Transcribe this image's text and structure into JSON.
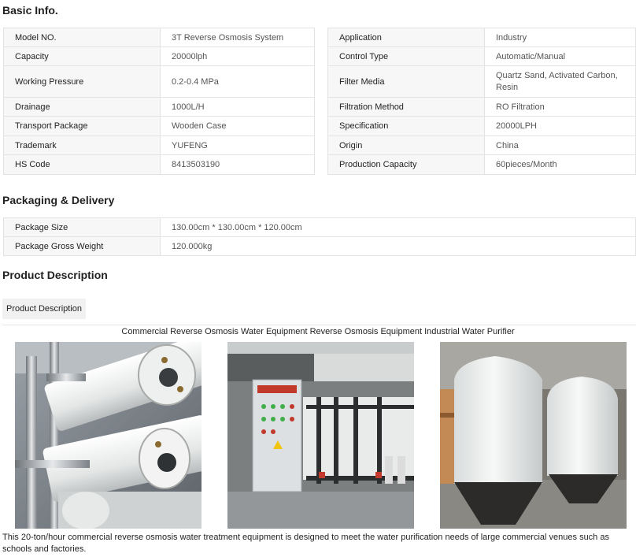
{
  "sections": {
    "basic": "Basic Info.",
    "packaging": "Packaging & Delivery",
    "product": "Product Description"
  },
  "basic_left": [
    {
      "k": "Model NO.",
      "v": "3T Reverse Osmosis System"
    },
    {
      "k": "Capacity",
      "v": "20000lph"
    },
    {
      "k": "Working Pressure",
      "v": "0.2-0.4 MPa"
    },
    {
      "k": "Drainage",
      "v": "1000L/H"
    },
    {
      "k": "Transport Package",
      "v": "Wooden Case"
    },
    {
      "k": "Trademark",
      "v": "YUFENG"
    },
    {
      "k": "HS Code",
      "v": "8413503190"
    }
  ],
  "basic_right": [
    {
      "k": "Application",
      "v": "Industry"
    },
    {
      "k": "Control Type",
      "v": "Automatic/Manual"
    },
    {
      "k": "Filter Media",
      "v": "Quartz Sand, Activated Carbon, Resin"
    },
    {
      "k": "Filtration Method",
      "v": "RO Filtration"
    },
    {
      "k": "Specification",
      "v": "20000LPH"
    },
    {
      "k": "Origin",
      "v": "China"
    },
    {
      "k": "Production Capacity",
      "v": "60pieces/Month"
    }
  ],
  "packaging": [
    {
      "k": "Package Size",
      "v": "130.00cm * 130.00cm * 120.00cm"
    },
    {
      "k": "Package Gross Weight",
      "v": "120.000kg"
    }
  ],
  "tab_label": "Product Description",
  "caption": "Commercial Reverse Osmosis Water Equipment Reverse Osmosis Equipment Industrial Water Purifier",
  "description": "This 20-ton/hour commercial reverse osmosis water treatment equipment is designed to meet the water purification needs of large commercial venues such as schools and factories."
}
